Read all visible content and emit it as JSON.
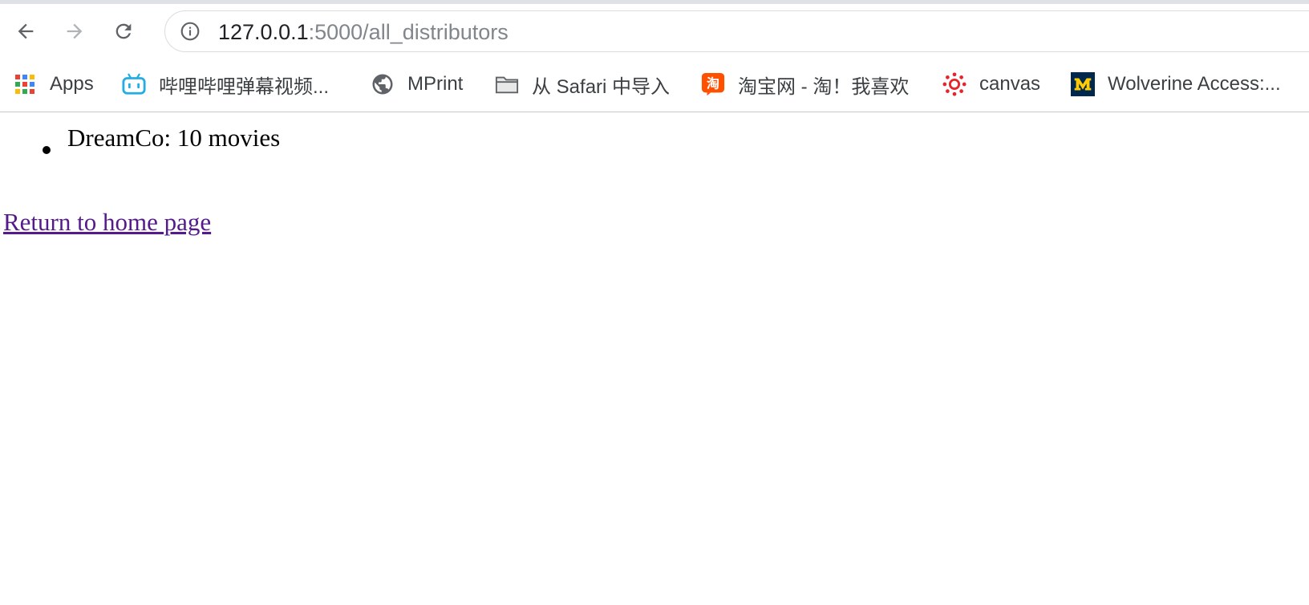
{
  "browser": {
    "url_host": "127.0.0.1",
    "url_rest": ":5000/all_distributors",
    "back_icon": "arrow-left-icon",
    "forward_icon": "arrow-right-icon",
    "reload_icon": "reload-icon",
    "site_info_icon": "info-icon"
  },
  "bookmarks": [
    {
      "label": "Apps",
      "icon": "apps-grid-icon"
    },
    {
      "label": "哔哩哔哩弹幕视频...",
      "icon": "bilibili-icon"
    },
    {
      "label": "MPrint",
      "icon": "globe-icon"
    },
    {
      "label": "从 Safari 中导入",
      "icon": "folder-icon"
    },
    {
      "label": "淘宝网 - 淘！我喜欢",
      "icon": "taobao-icon"
    },
    {
      "label": "canvas",
      "icon": "canvas-icon"
    },
    {
      "label": "Wolverine Access:...",
      "icon": "michigan-m-icon"
    }
  ],
  "page": {
    "distributors": [
      {
        "text": "DreamCo: 10 movies"
      }
    ],
    "home_link": "Return to home page"
  },
  "colors": {
    "visited_link": "#551a8b",
    "url_muted": "#80868b",
    "omnibox_border": "#dadce0"
  }
}
